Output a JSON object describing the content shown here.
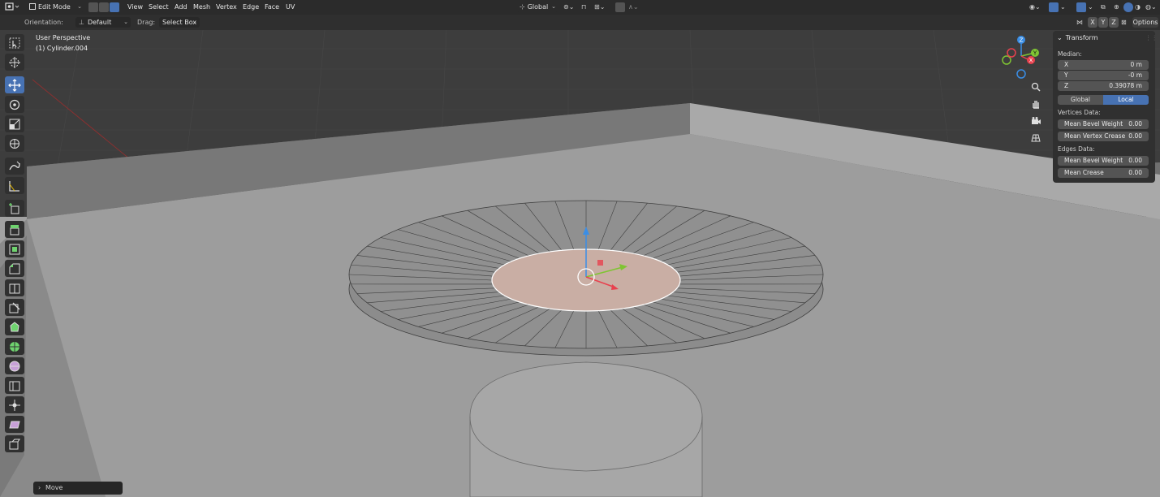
{
  "header": {
    "mode": "Edit Mode",
    "menus": [
      "View",
      "Select",
      "Add",
      "Mesh",
      "Vertex",
      "Edge",
      "Face",
      "UV"
    ],
    "transform_orientation": "Global",
    "options_label": "Options",
    "axis_labels": [
      "X",
      "Y",
      "Z"
    ]
  },
  "subheader": {
    "orientation_label": "Orientation:",
    "orientation_value": "Default",
    "drag_label": "Drag:",
    "drag_value": "Select Box"
  },
  "viewport": {
    "view_name": "User Perspective",
    "object_name": "(1) Cylinder.004",
    "gizmo": {
      "x": "X",
      "y": "Y",
      "z": "Z"
    }
  },
  "panel": {
    "title": "Transform",
    "median_label": "Median:",
    "fields": [
      {
        "label": "X",
        "value": "0 m"
      },
      {
        "label": "Y",
        "value": "-0 m"
      },
      {
        "label": "Z",
        "value": "0.39078 m"
      }
    ],
    "global_label": "Global",
    "local_label": "Local",
    "vertices_label": "Vertices Data:",
    "vertices_fields": [
      {
        "label": "Mean Bevel Weight",
        "value": "0.00"
      },
      {
        "label": "Mean Vertex Crease",
        "value": "0.00"
      }
    ],
    "edges_label": "Edges Data:",
    "edges_fields": [
      {
        "label": "Mean Bevel Weight",
        "value": "0.00"
      },
      {
        "label": "Mean Crease",
        "value": "0.00"
      }
    ]
  },
  "status": {
    "last_operator": "Move"
  },
  "tools": [
    "select-box",
    "cursor",
    "move",
    "rotate",
    "scale",
    "transform",
    "annotate",
    "measure",
    "add-cube",
    "extrude-region",
    "inset-faces",
    "bevel",
    "loop-cut",
    "knife",
    "poly-build",
    "spin",
    "smooth",
    "edge-slide",
    "shrink-fatten",
    "shear",
    "rip-region"
  ],
  "colors": {
    "active": "#4772b3",
    "axis_x": "#e8414e",
    "axis_y": "#7fc433",
    "axis_z": "#3a8ee6"
  }
}
